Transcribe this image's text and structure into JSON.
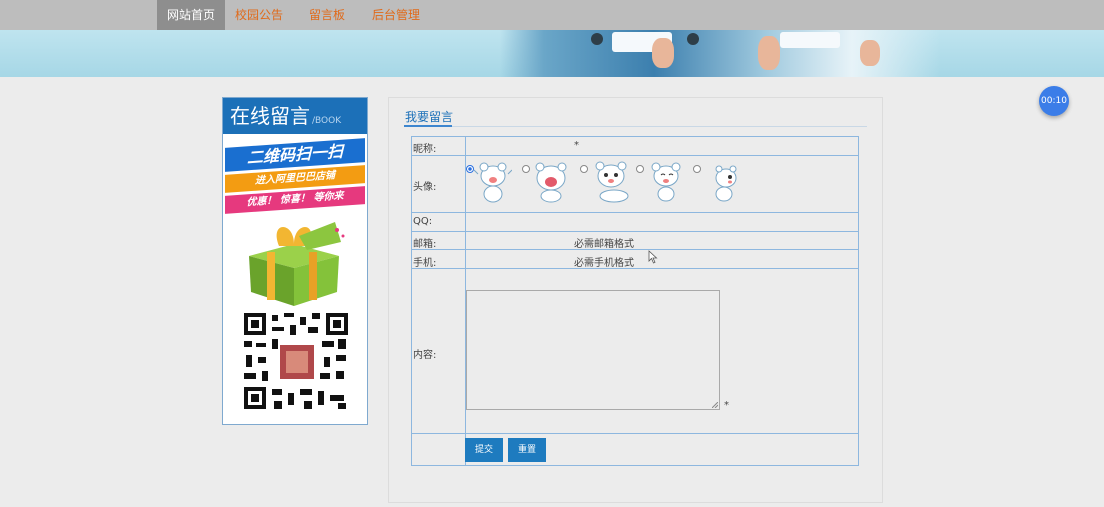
{
  "nav": {
    "items": [
      "网站首页",
      "校园公告",
      "留言板",
      "后台管理"
    ],
    "active_index": 0
  },
  "timer": {
    "label": "00:10"
  },
  "ad": {
    "title_big": "在线留言",
    "title_small": "/BOOK",
    "qr_banner": "二维码扫一扫",
    "orange_line": "进入阿里巴巴店铺",
    "pink_line": "优惠！ 惊喜！ 等你来"
  },
  "form": {
    "title": "我要留言",
    "fields": {
      "nickname_label": "昵称:",
      "nickname_required": "*",
      "avatar_label": "头像:",
      "qq_label": "QQ:",
      "email_label": "邮箱:",
      "email_hint": "必需邮箱格式",
      "phone_label": "手机:",
      "phone_hint": "必需手机格式",
      "content_label": "内容:",
      "content_required": "*"
    },
    "avatar_selected_index": 0,
    "buttons": {
      "submit": "提交",
      "reset": "重置"
    }
  },
  "colors": {
    "accent": "#1e7bbf",
    "nav_text": "#e06a1a",
    "title": "#1a6fb8"
  }
}
